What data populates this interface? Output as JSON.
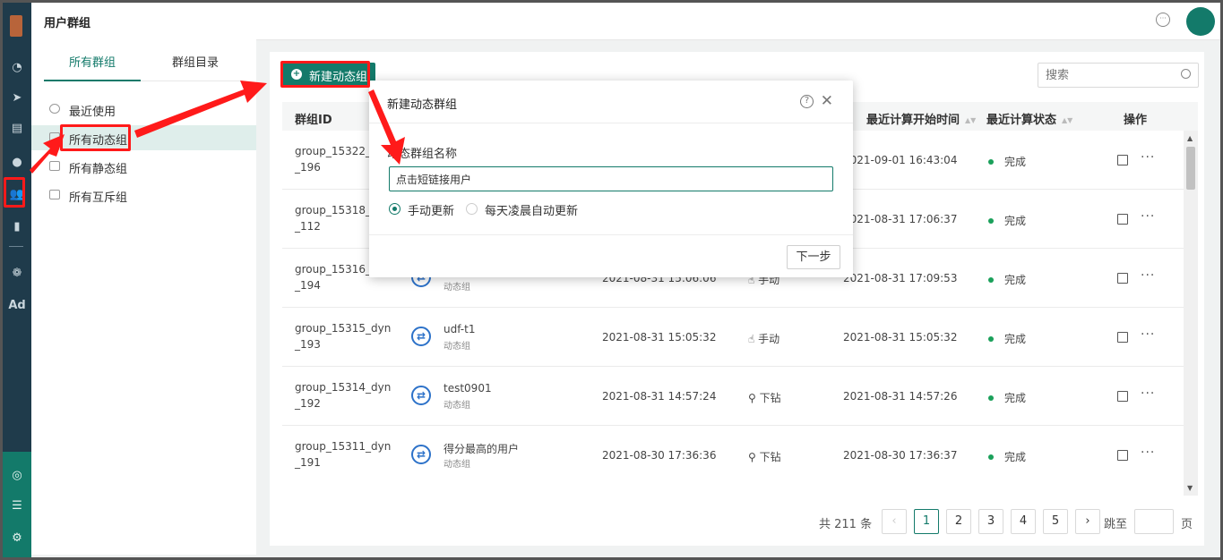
{
  "header": {
    "title": "用户群组"
  },
  "left_tabs": [
    {
      "label": "所有群组",
      "active": true
    },
    {
      "label": "群组目录",
      "active": false
    }
  ],
  "nav_items": [
    {
      "label": "最近使用",
      "icon": "clock-icon"
    },
    {
      "label": "所有动态组",
      "icon": "folder-icon",
      "selected": true
    },
    {
      "label": "所有静态组",
      "icon": "folder-icon"
    },
    {
      "label": "所有互斥组",
      "icon": "folder-icon"
    }
  ],
  "toolbar": {
    "new_button": "新建动态组",
    "search_placeholder": "搜索"
  },
  "table": {
    "headers": [
      "群组ID",
      "最近计算开始时间",
      "最近计算状态",
      "操作"
    ],
    "rows": [
      {
        "id_line1": "group_15322_d",
        "id_line2": "_196",
        "name": "",
        "type": "",
        "created": "",
        "mode": "",
        "start": "2021-09-01 16:43:04",
        "status": "完成"
      },
      {
        "id_line1": "group_15318_d",
        "id_line2": "_112",
        "name": "",
        "type": "",
        "created": "",
        "mode": "",
        "start": "2021-08-31 17:06:37",
        "status": "完成"
      },
      {
        "id_line1": "group_15316_d",
        "id_line2": "_194",
        "name": "",
        "type": "动态组",
        "created": "2021-08-31 15:06:06",
        "mode": "手动",
        "start": "2021-08-31 17:09:53",
        "status": "完成"
      },
      {
        "id_line1": "group_15315_dyn",
        "id_line2": "_193",
        "name": "udf-t1",
        "type": "动态组",
        "created": "2021-08-31 15:05:32",
        "mode": "手动",
        "start": "2021-08-31 15:05:32",
        "status": "完成"
      },
      {
        "id_line1": "group_15314_dyn",
        "id_line2": "_192",
        "name": "test0901",
        "type": "动态组",
        "created": "2021-08-31 14:57:24",
        "mode": "下钻",
        "start": "2021-08-31 14:57:26",
        "status": "完成"
      },
      {
        "id_line1": "group_15311_dyn",
        "id_line2": "_191",
        "name": "得分最高的用户",
        "type": "动态组",
        "created": "2021-08-30 17:36:36",
        "mode": "下钻",
        "start": "2021-08-30 17:36:37",
        "status": "完成"
      }
    ]
  },
  "pagination": {
    "total": "共 211 条",
    "pages": [
      "1",
      "2",
      "3",
      "4",
      "5"
    ],
    "current": "1",
    "jump_label": "跳至",
    "page_label": "页"
  },
  "dialog": {
    "title": "新建动态群组",
    "field_label": "动态群组名称",
    "field_value": "点击短链接用户",
    "radio_manual": "手动更新",
    "radio_auto": "每天凌晨自动更新",
    "next_button": "下一步"
  },
  "colors": {
    "brand": "#137a6a",
    "rail": "#1f3b4b",
    "annotation": "#ff1a1a",
    "status_ok": "#1aa05a",
    "type_icon": "#2d72c9"
  }
}
